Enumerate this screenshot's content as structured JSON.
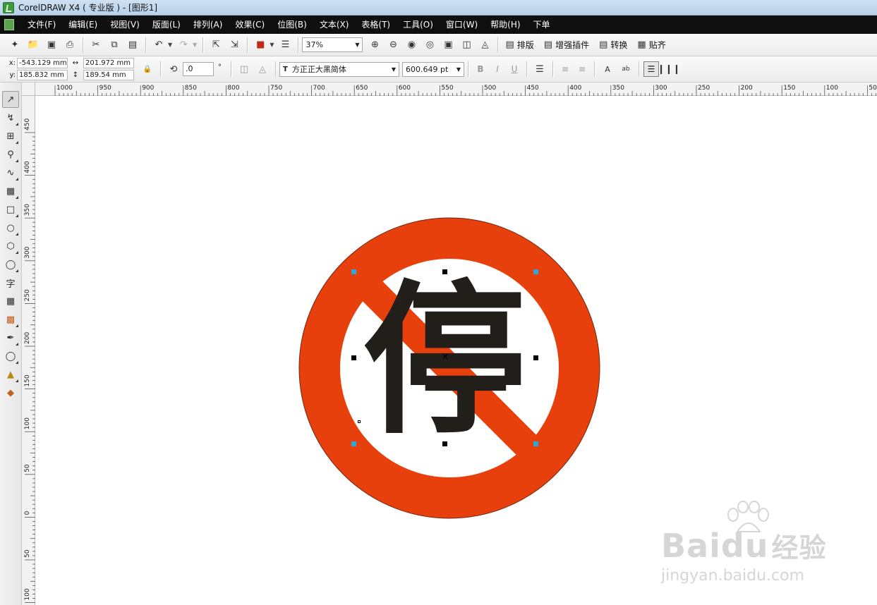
{
  "window": {
    "title": "CorelDRAW X4 ( 专业版 ) - [图形1]"
  },
  "menu": {
    "items": [
      {
        "label": "文件(F)"
      },
      {
        "label": "编辑(E)"
      },
      {
        "label": "视图(V)"
      },
      {
        "label": "版面(L)"
      },
      {
        "label": "排列(A)"
      },
      {
        "label": "效果(C)"
      },
      {
        "label": "位图(B)"
      },
      {
        "label": "文本(X)"
      },
      {
        "label": "表格(T)"
      },
      {
        "label": "工具(O)"
      },
      {
        "label": "窗口(W)"
      },
      {
        "label": "帮助(H)"
      },
      {
        "label": "下单"
      }
    ]
  },
  "standard_toolbar": {
    "zoom_level": "37%",
    "text_buttons": [
      {
        "label": "排版",
        "icon": "layout-icon"
      },
      {
        "label": "增强插件",
        "icon": "plugin-icon"
      },
      {
        "label": "转换",
        "icon": "convert-icon"
      },
      {
        "label": "贴齐",
        "icon": "snap-icon"
      }
    ]
  },
  "property_bar": {
    "x_label": "x:",
    "x_value": "-543.129 mm",
    "y_label": "y:",
    "y_value": "185.832 mm",
    "width_value": "201.972 mm",
    "height_value": "189.54 mm",
    "angle_value": ".0",
    "angle_unit": "°",
    "font_name": "方正正大黑简体",
    "font_size": "600.649 pt"
  },
  "ruler": {
    "horizontal_labels": [
      "1000",
      "950",
      "900",
      "850",
      "800",
      "750",
      "700",
      "650",
      "600",
      "550",
      "500",
      "450",
      "400",
      "350",
      "300",
      "250",
      "200",
      "150",
      "100",
      "50"
    ],
    "vertical_labels": [
      "450",
      "400",
      "350",
      "300",
      "250",
      "200",
      "150",
      "100",
      "50",
      "0",
      "50",
      "100"
    ]
  },
  "artwork": {
    "character": "停",
    "ring_color": "#e8400c",
    "text_color": "#221f1b",
    "handle_color": "#2aa8dc"
  },
  "watermark": {
    "brand": "Bai",
    "brand_mid": "du",
    "brand_cn": "经验",
    "url": "jingyan.baidu.com"
  },
  "toolbox": {
    "tools": [
      "pick-tool-icon",
      "shape-tool-icon",
      "crop-tool-icon",
      "zoom-tool-icon",
      "freehand-tool-icon",
      "smart-fill-tool-icon",
      "rectangle-tool-icon",
      "ellipse-tool-icon",
      "polygon-tool-icon",
      "basic-shapes-tool-icon",
      "text-tool-icon",
      "table-tool-icon",
      "interactive-blend-tool-icon",
      "eyedropper-tool-icon",
      "outline-tool-icon",
      "fill-tool-icon",
      "interactive-fill-tool-icon"
    ],
    "text_tool_label": "字"
  }
}
